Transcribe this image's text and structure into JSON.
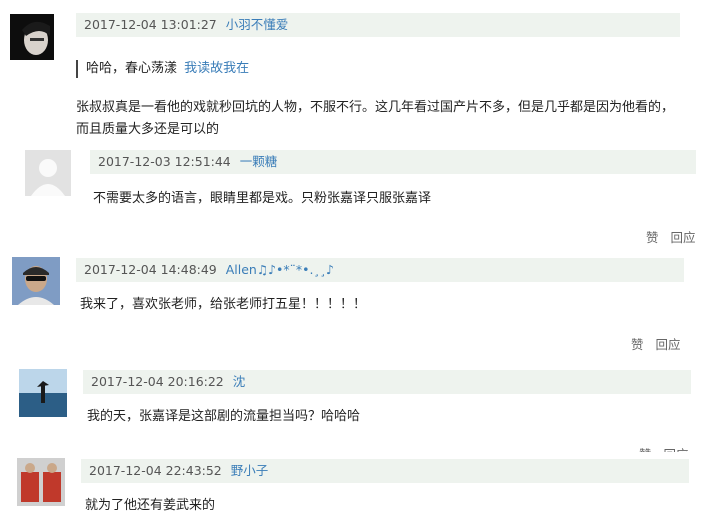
{
  "comments": [
    {
      "timestamp": "2017-12-04 13:01:27",
      "username": "小羽不懂爱",
      "quote_text": "哈哈，春心荡漾",
      "quote_link": "我读故我在",
      "body_line1": "张叔叔真是一看他的戏就秒回坑的人物，不服不行。这几年看过国产片不多，但是几乎都是因为他看的，",
      "body_line2": "而且质量大多还是可以的"
    },
    {
      "timestamp": "2017-12-03 12:51:44",
      "username": "一颗糖",
      "body": "不需要太多的语言，眼睛里都是戏。只粉张嘉译只服张嘉译",
      "like": "赞",
      "reply": "回应"
    },
    {
      "timestamp": "2017-12-04 14:48:49",
      "username": "Allen♫♪•*¨*•.¸¸♪",
      "body": "我来了，喜欢张老师，给张老师打五星！！！！！",
      "like": "赞",
      "reply": "回应"
    },
    {
      "timestamp": "2017-12-04 20:16:22",
      "username": "沈",
      "body": "我的天，张嘉译是这部剧的流量担当吗？哈哈哈",
      "like": "赞",
      "reply": "回应"
    },
    {
      "timestamp": "2017-12-04 22:43:52",
      "username": "野小子",
      "body": "就为了他还有姜武来的"
    }
  ]
}
